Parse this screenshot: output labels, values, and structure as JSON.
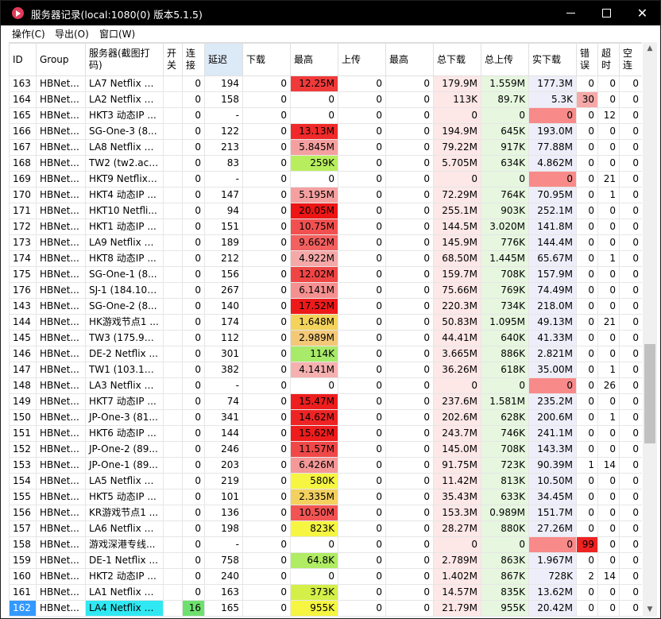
{
  "window": {
    "title": "服务器记录(local:1080(0) 版本5.1.5)",
    "minimize_glyph": "",
    "maximize_glyph": "",
    "close_glyph": "✕"
  },
  "menu": [
    {
      "label": "操作(C)"
    },
    {
      "label": "导出(O)"
    },
    {
      "label": "窗口(W)"
    }
  ],
  "columns": [
    {
      "label": "ID"
    },
    {
      "label": "Group"
    },
    {
      "label": "服务器(截图打码)"
    },
    {
      "label": "开关"
    },
    {
      "label": "连接"
    },
    {
      "label": "延迟"
    },
    {
      "label": "下载"
    },
    {
      "label": "最高"
    },
    {
      "label": "上传"
    },
    {
      "label": "最高"
    },
    {
      "label": "总下载"
    },
    {
      "label": "总上传"
    },
    {
      "label": "实下载"
    },
    {
      "label": "错误"
    },
    {
      "label": "超时"
    },
    {
      "label": "空连"
    }
  ],
  "colors": {
    "max_red_strong": "#f21b1b",
    "max_red": "#f45a5a",
    "max_pink": "#f5a0a0",
    "max_yellow": "#f5f542",
    "max_orange_yellow": "#f3d35b",
    "max_green": "#b8ee5e",
    "total_dl_bg": "#fde7e7",
    "total_ul_bg": "#e6f6df",
    "real_dl_bg": "#eeeefa",
    "zero_red": "#f88a8a",
    "error_red": "#ee2222",
    "error_pink": "#f7a3a3",
    "selected_id_bg": "#3399ff",
    "selected_server_bg": "#2fe8f2",
    "selected_conn_bg": "#6fe06f",
    "latency_header_bg": "#dce9f7"
  },
  "rows": [
    {
      "id": "163",
      "group": "HBNet...",
      "server": "LA7 Netflix U...",
      "open": "",
      "conn": "0",
      "lat": "194",
      "dl": "0",
      "max": "12.25M",
      "ul": "0",
      "max2": "0",
      "tdl": "179.9M",
      "tul": "1.559M",
      "rdl": "177.3M",
      "err": "0",
      "tmo": "0",
      "idle": "0",
      "max_bg": "#f03a3a",
      "tdl_bg": "#fde7e7",
      "tul_bg": "#e6f6df",
      "rdl_bg": "#eeeefa",
      "err_bg": ""
    },
    {
      "id": "164",
      "group": "HBNet...",
      "server": "LA2 Netflix U...",
      "open": "",
      "conn": "0",
      "lat": "158",
      "dl": "0",
      "max": "0",
      "ul": "0",
      "max2": "0",
      "tdl": "113K",
      "tul": "89.7K",
      "rdl": "5.3K",
      "err": "30",
      "tmo": "0",
      "idle": "0",
      "max_bg": "",
      "tdl_bg": "#fde7e7",
      "tul_bg": "#e6f6df",
      "rdl_bg": "#eeeefa",
      "err_bg": "#f5a8a8"
    },
    {
      "id": "165",
      "group": "HBNet...",
      "server": "HKT3 动态IP ...",
      "open": "",
      "conn": "0",
      "lat": "-",
      "dl": "0",
      "max": "0",
      "ul": "0",
      "max2": "0",
      "tdl": "0",
      "tul": "0",
      "rdl": "0",
      "err": "0",
      "tmo": "12",
      "idle": "0",
      "max_bg": "",
      "tdl_bg": "#fde7e7",
      "tul_bg": "#e6f6df",
      "rdl_bg": "#f88a8a",
      "err_bg": ""
    },
    {
      "id": "166",
      "group": "HBNet...",
      "server": "SG-One-3 (8...",
      "open": "",
      "conn": "0",
      "lat": "122",
      "dl": "0",
      "max": "13.13M",
      "ul": "0",
      "max2": "0",
      "tdl": "194.9M",
      "tul": "645K",
      "rdl": "193.0M",
      "err": "0",
      "tmo": "0",
      "idle": "0",
      "max_bg": "#f02a2a",
      "tdl_bg": "#fde7e7",
      "tul_bg": "#e6f6df",
      "rdl_bg": "#eeeefa",
      "err_bg": ""
    },
    {
      "id": "167",
      "group": "HBNet...",
      "server": "LA8 Netflix U...",
      "open": "",
      "conn": "0",
      "lat": "213",
      "dl": "0",
      "max": "5.845M",
      "ul": "0",
      "max2": "0",
      "tdl": "79.22M",
      "tul": "917K",
      "rdl": "77.88M",
      "err": "0",
      "tmo": "0",
      "idle": "0",
      "max_bg": "#f5a0a0",
      "tdl_bg": "#fde7e7",
      "tul_bg": "#e6f6df",
      "rdl_bg": "#eeeefa",
      "err_bg": ""
    },
    {
      "id": "168",
      "group": "HBNet...",
      "server": "TW2 (tw2.acc...",
      "open": "",
      "conn": "0",
      "lat": "83",
      "dl": "0",
      "max": "259K",
      "ul": "0",
      "max2": "0",
      "tdl": "5.705M",
      "tul": "634K",
      "rdl": "4.862M",
      "err": "0",
      "tmo": "0",
      "idle": "0",
      "max_bg": "#b8ee5e",
      "tdl_bg": "#fde7e7",
      "tul_bg": "#e6f6df",
      "rdl_bg": "#eeeefa",
      "err_bg": ""
    },
    {
      "id": "169",
      "group": "HBNet...",
      "server": "HKT9 Netflix ...",
      "open": "",
      "conn": "0",
      "lat": "-",
      "dl": "0",
      "max": "0",
      "ul": "0",
      "max2": "0",
      "tdl": "0",
      "tul": "0",
      "rdl": "0",
      "err": "0",
      "tmo": "21",
      "idle": "0",
      "max_bg": "",
      "tdl_bg": "#fde7e7",
      "tul_bg": "#e6f6df",
      "rdl_bg": "#f88a8a",
      "err_bg": ""
    },
    {
      "id": "170",
      "group": "HBNet...",
      "server": "HKT4 动态IP ...",
      "open": "",
      "conn": "0",
      "lat": "147",
      "dl": "0",
      "max": "5.195M",
      "ul": "0",
      "max2": "0",
      "tdl": "72.29M",
      "tul": "764K",
      "rdl": "70.95M",
      "err": "0",
      "tmo": "1",
      "idle": "0",
      "max_bg": "#f5a0a0",
      "tdl_bg": "#fde7e7",
      "tul_bg": "#e6f6df",
      "rdl_bg": "#eeeefa",
      "err_bg": ""
    },
    {
      "id": "171",
      "group": "HBNet...",
      "server": "HKT10 Netfli...",
      "open": "",
      "conn": "0",
      "lat": "94",
      "dl": "0",
      "max": "20.05M",
      "ul": "0",
      "max2": "0",
      "tdl": "255.1M",
      "tul": "903K",
      "rdl": "252.1M",
      "err": "0",
      "tmo": "0",
      "idle": "0",
      "max_bg": "#ee1515",
      "tdl_bg": "#fde7e7",
      "tul_bg": "#e6f6df",
      "rdl_bg": "#eeeefa",
      "err_bg": ""
    },
    {
      "id": "172",
      "group": "HBNet...",
      "server": "HKT1 动态IP ...",
      "open": "",
      "conn": "0",
      "lat": "151",
      "dl": "0",
      "max": "10.75M",
      "ul": "0",
      "max2": "0",
      "tdl": "144.5M",
      "tul": "3.020M",
      "rdl": "141.8M",
      "err": "0",
      "tmo": "0",
      "idle": "0",
      "max_bg": "#f25050",
      "tdl_bg": "#fde7e7",
      "tul_bg": "#e6f6df",
      "rdl_bg": "#eeeefa",
      "err_bg": ""
    },
    {
      "id": "173",
      "group": "HBNet...",
      "server": "LA9 Netflix U...",
      "open": "",
      "conn": "0",
      "lat": "189",
      "dl": "0",
      "max": "9.662M",
      "ul": "0",
      "max2": "0",
      "tdl": "145.9M",
      "tul": "776K",
      "rdl": "144.4M",
      "err": "0",
      "tmo": "0",
      "idle": "0",
      "max_bg": "#f36060",
      "tdl_bg": "#fde7e7",
      "tul_bg": "#e6f6df",
      "rdl_bg": "#eeeefa",
      "err_bg": ""
    },
    {
      "id": "174",
      "group": "HBNet...",
      "server": "HKT8 动态IP ...",
      "open": "",
      "conn": "0",
      "lat": "212",
      "dl": "0",
      "max": "4.922M",
      "ul": "0",
      "max2": "0",
      "tdl": "68.50M",
      "tul": "1.445M",
      "rdl": "65.67M",
      "err": "0",
      "tmo": "1",
      "idle": "0",
      "max_bg": "#f5a8a8",
      "tdl_bg": "#fde7e7",
      "tul_bg": "#e6f6df",
      "rdl_bg": "#eeeefa",
      "err_bg": ""
    },
    {
      "id": "175",
      "group": "HBNet...",
      "server": "SG-One-1 (8...",
      "open": "",
      "conn": "0",
      "lat": "156",
      "dl": "0",
      "max": "12.02M",
      "ul": "0",
      "max2": "0",
      "tdl": "159.7M",
      "tul": "708K",
      "rdl": "157.9M",
      "err": "0",
      "tmo": "0",
      "idle": "0",
      "max_bg": "#f04545",
      "tdl_bg": "#fde7e7",
      "tul_bg": "#e6f6df",
      "rdl_bg": "#eeeefa",
      "err_bg": ""
    },
    {
      "id": "176",
      "group": "HBNet...",
      "server": "SJ-1 (184.105...",
      "open": "",
      "conn": "0",
      "lat": "267",
      "dl": "0",
      "max": "6.141M",
      "ul": "0",
      "max2": "0",
      "tdl": "75.66M",
      "tul": "769K",
      "rdl": "74.49M",
      "err": "0",
      "tmo": "0",
      "idle": "0",
      "max_bg": "#f59090",
      "tdl_bg": "#fde7e7",
      "tul_bg": "#e6f6df",
      "rdl_bg": "#eeeefa",
      "err_bg": ""
    },
    {
      "id": "143",
      "group": "HBNet...",
      "server": "SG-One-2 (8...",
      "open": "",
      "conn": "0",
      "lat": "140",
      "dl": "0",
      "max": "17.52M",
      "ul": "0",
      "max2": "0",
      "tdl": "220.3M",
      "tul": "734K",
      "rdl": "218.0M",
      "err": "0",
      "tmo": "0",
      "idle": "0",
      "max_bg": "#ee1a1a",
      "tdl_bg": "#fde7e7",
      "tul_bg": "#e6f6df",
      "rdl_bg": "#eeeefa",
      "err_bg": ""
    },
    {
      "id": "144",
      "group": "HBNet...",
      "server": "HK游戏节点1 ...",
      "open": "",
      "conn": "0",
      "lat": "174",
      "dl": "0",
      "max": "1.648M",
      "ul": "0",
      "max2": "0",
      "tdl": "50.83M",
      "tul": "1.095M",
      "rdl": "49.13M",
      "err": "0",
      "tmo": "21",
      "idle": "0",
      "max_bg": "#f3d35b",
      "tdl_bg": "#fde7e7",
      "tul_bg": "#e6f6df",
      "rdl_bg": "#eeeefa",
      "err_bg": ""
    },
    {
      "id": "145",
      "group": "HBNet...",
      "server": "TW3 (175.98....",
      "open": "",
      "conn": "0",
      "lat": "112",
      "dl": "0",
      "max": "2.989M",
      "ul": "0",
      "max2": "0",
      "tdl": "44.41M",
      "tul": "640K",
      "rdl": "41.33M",
      "err": "0",
      "tmo": "0",
      "idle": "0",
      "max_bg": "#f3c978",
      "tdl_bg": "#fde7e7",
      "tul_bg": "#e6f6df",
      "rdl_bg": "#eeeefa",
      "err_bg": ""
    },
    {
      "id": "146",
      "group": "HBNet...",
      "server": "DE-2 Netflix ...",
      "open": "",
      "conn": "0",
      "lat": "301",
      "dl": "0",
      "max": "114K",
      "ul": "0",
      "max2": "0",
      "tdl": "3.665M",
      "tul": "886K",
      "rdl": "2.821M",
      "err": "0",
      "tmo": "0",
      "idle": "0",
      "max_bg": "#a8ea6a",
      "tdl_bg": "#fde7e7",
      "tul_bg": "#e6f6df",
      "rdl_bg": "#eeeefa",
      "err_bg": ""
    },
    {
      "id": "147",
      "group": "HBNet...",
      "server": "TW1 (103.17....",
      "open": "",
      "conn": "0",
      "lat": "382",
      "dl": "0",
      "max": "4.141M",
      "ul": "0",
      "max2": "0",
      "tdl": "36.26M",
      "tul": "618K",
      "rdl": "35.00M",
      "err": "0",
      "tmo": "1",
      "idle": "0",
      "max_bg": "#f5b0b0",
      "tdl_bg": "#fde7e7",
      "tul_bg": "#e6f6df",
      "rdl_bg": "#eeeefa",
      "err_bg": ""
    },
    {
      "id": "148",
      "group": "HBNet...",
      "server": "LA3 Netflix U...",
      "open": "",
      "conn": "0",
      "lat": "-",
      "dl": "0",
      "max": "0",
      "ul": "0",
      "max2": "0",
      "tdl": "0",
      "tul": "0",
      "rdl": "0",
      "err": "0",
      "tmo": "26",
      "idle": "0",
      "max_bg": "",
      "tdl_bg": "#fde7e7",
      "tul_bg": "#e6f6df",
      "rdl_bg": "#f88a8a",
      "err_bg": ""
    },
    {
      "id": "149",
      "group": "HBNet...",
      "server": "HKT7 动态IP ...",
      "open": "",
      "conn": "0",
      "lat": "74",
      "dl": "0",
      "max": "15.47M",
      "ul": "0",
      "max2": "0",
      "tdl": "237.6M",
      "tul": "1.581M",
      "rdl": "235.2M",
      "err": "0",
      "tmo": "0",
      "idle": "0",
      "max_bg": "#ee1e1e",
      "tdl_bg": "#fde7e7",
      "tul_bg": "#e6f6df",
      "rdl_bg": "#eeeefa",
      "err_bg": ""
    },
    {
      "id": "150",
      "group": "HBNet...",
      "server": "JP-One-3 (81...",
      "open": "",
      "conn": "0",
      "lat": "341",
      "dl": "0",
      "max": "14.62M",
      "ul": "0",
      "max2": "0",
      "tdl": "202.6M",
      "tul": "628K",
      "rdl": "200.6M",
      "err": "0",
      "tmo": "1",
      "idle": "0",
      "max_bg": "#ee2424",
      "tdl_bg": "#fde7e7",
      "tul_bg": "#e6f6df",
      "rdl_bg": "#eeeefa",
      "err_bg": ""
    },
    {
      "id": "151",
      "group": "HBNet...",
      "server": "HKT6 动态IP ...",
      "open": "",
      "conn": "0",
      "lat": "144",
      "dl": "0",
      "max": "15.62M",
      "ul": "0",
      "max2": "0",
      "tdl": "243.7M",
      "tul": "746K",
      "rdl": "241.1M",
      "err": "0",
      "tmo": "0",
      "idle": "0",
      "max_bg": "#ee1c1c",
      "tdl_bg": "#fde7e7",
      "tul_bg": "#e6f6df",
      "rdl_bg": "#eeeefa",
      "err_bg": ""
    },
    {
      "id": "152",
      "group": "HBNet...",
      "server": "JP-One-2 (89...",
      "open": "",
      "conn": "0",
      "lat": "246",
      "dl": "0",
      "max": "11.57M",
      "ul": "0",
      "max2": "0",
      "tdl": "145.0M",
      "tul": "708K",
      "rdl": "143.3M",
      "err": "0",
      "tmo": "0",
      "idle": "0",
      "max_bg": "#f04848",
      "tdl_bg": "#fde7e7",
      "tul_bg": "#e6f6df",
      "rdl_bg": "#eeeefa",
      "err_bg": ""
    },
    {
      "id": "153",
      "group": "HBNet...",
      "server": "JP-One-1 (89...",
      "open": "",
      "conn": "0",
      "lat": "203",
      "dl": "0",
      "max": "6.426M",
      "ul": "0",
      "max2": "0",
      "tdl": "91.75M",
      "tul": "723K",
      "rdl": "90.39M",
      "err": "1",
      "tmo": "14",
      "idle": "0",
      "max_bg": "#f59898",
      "tdl_bg": "#fde7e7",
      "tul_bg": "#e6f6df",
      "rdl_bg": "#eeeefa",
      "err_bg": ""
    },
    {
      "id": "154",
      "group": "HBNet...",
      "server": "LA5 Netflix U...",
      "open": "",
      "conn": "0",
      "lat": "219",
      "dl": "0",
      "max": "580K",
      "ul": "0",
      "max2": "0",
      "tdl": "11.42M",
      "tul": "813K",
      "rdl": "10.50M",
      "err": "0",
      "tmo": "0",
      "idle": "0",
      "max_bg": "#f5f542",
      "tdl_bg": "#fde7e7",
      "tul_bg": "#e6f6df",
      "rdl_bg": "#eeeefa",
      "err_bg": ""
    },
    {
      "id": "155",
      "group": "HBNet...",
      "server": "HKT5 动态IP ...",
      "open": "",
      "conn": "0",
      "lat": "101",
      "dl": "0",
      "max": "2.335M",
      "ul": "0",
      "max2": "0",
      "tdl": "35.43M",
      "tul": "633K",
      "rdl": "34.45M",
      "err": "0",
      "tmo": "0",
      "idle": "0",
      "max_bg": "#f3d05f",
      "tdl_bg": "#fde7e7",
      "tul_bg": "#e6f6df",
      "rdl_bg": "#eeeefa",
      "err_bg": ""
    },
    {
      "id": "156",
      "group": "HBNet...",
      "server": "KR游戏节点1 ...",
      "open": "",
      "conn": "0",
      "lat": "136",
      "dl": "0",
      "max": "10.50M",
      "ul": "0",
      "max2": "0",
      "tdl": "153.3M",
      "tul": "0.989M",
      "rdl": "151.7M",
      "err": "0",
      "tmo": "0",
      "idle": "0",
      "max_bg": "#f25454",
      "tdl_bg": "#fde7e7",
      "tul_bg": "#e6f6df",
      "rdl_bg": "#eeeefa",
      "err_bg": ""
    },
    {
      "id": "157",
      "group": "HBNet...",
      "server": "LA6 Netflix U...",
      "open": "",
      "conn": "0",
      "lat": "198",
      "dl": "0",
      "max": "823K",
      "ul": "0",
      "max2": "0",
      "tdl": "28.27M",
      "tul": "880K",
      "rdl": "27.26M",
      "err": "0",
      "tmo": "0",
      "idle": "0",
      "max_bg": "#f5f542",
      "tdl_bg": "#fde7e7",
      "tul_bg": "#e6f6df",
      "rdl_bg": "#eeeefa",
      "err_bg": ""
    },
    {
      "id": "158",
      "group": "HBNet...",
      "server": "游戏深港专线...",
      "open": "",
      "conn": "0",
      "lat": "-",
      "dl": "0",
      "max": "0",
      "ul": "0",
      "max2": "0",
      "tdl": "0",
      "tul": "0",
      "rdl": "0",
      "err": "99",
      "tmo": "0",
      "idle": "0",
      "max_bg": "",
      "tdl_bg": "#fde7e7",
      "tul_bg": "#e6f6df",
      "rdl_bg": "#f88a8a",
      "err_bg": "#ee2222"
    },
    {
      "id": "159",
      "group": "HBNet...",
      "server": "DE-1 Netflix ...",
      "open": "",
      "conn": "0",
      "lat": "758",
      "dl": "0",
      "max": "64.8K",
      "ul": "0",
      "max2": "0",
      "tdl": "2.789M",
      "tul": "863K",
      "rdl": "1.967M",
      "err": "0",
      "tmo": "0",
      "idle": "0",
      "max_bg": "#b0ec64",
      "tdl_bg": "#fde7e7",
      "tul_bg": "#e6f6df",
      "rdl_bg": "#eeeefa",
      "err_bg": ""
    },
    {
      "id": "160",
      "group": "HBNet...",
      "server": "HKT2 动态IP ...",
      "open": "",
      "conn": "0",
      "lat": "240",
      "dl": "0",
      "max": "0",
      "ul": "0",
      "max2": "0",
      "tdl": "1.402M",
      "tul": "867K",
      "rdl": "728K",
      "err": "2",
      "tmo": "14",
      "idle": "0",
      "max_bg": "",
      "tdl_bg": "#fde7e7",
      "tul_bg": "#e6f6df",
      "rdl_bg": "#eeeefa",
      "err_bg": ""
    },
    {
      "id": "161",
      "group": "HBNet...",
      "server": "LA1 Netflix U...",
      "open": "",
      "conn": "0",
      "lat": "163",
      "dl": "0",
      "max": "373K",
      "ul": "0",
      "max2": "0",
      "tdl": "14.57M",
      "tul": "835K",
      "rdl": "13.62M",
      "err": "0",
      "tmo": "0",
      "idle": "0",
      "max_bg": "#d4f048",
      "tdl_bg": "#fde7e7",
      "tul_bg": "#e6f6df",
      "rdl_bg": "#eeeefa",
      "err_bg": ""
    },
    {
      "id": "162",
      "group": "HBNet...",
      "server": "LA4 Netflix U...",
      "open": "",
      "conn": "16",
      "lat": "165",
      "dl": "0",
      "max": "955K",
      "ul": "0",
      "max2": "0",
      "tdl": "21.79M",
      "tul": "955K",
      "rdl": "20.42M",
      "err": "0",
      "tmo": "0",
      "idle": "0",
      "max_bg": "#f5f542",
      "tdl_bg": "#fde7e7",
      "tul_bg": "#e6f6df",
      "rdl_bg": "#eeeefa",
      "err_bg": "",
      "selected": true
    }
  ]
}
